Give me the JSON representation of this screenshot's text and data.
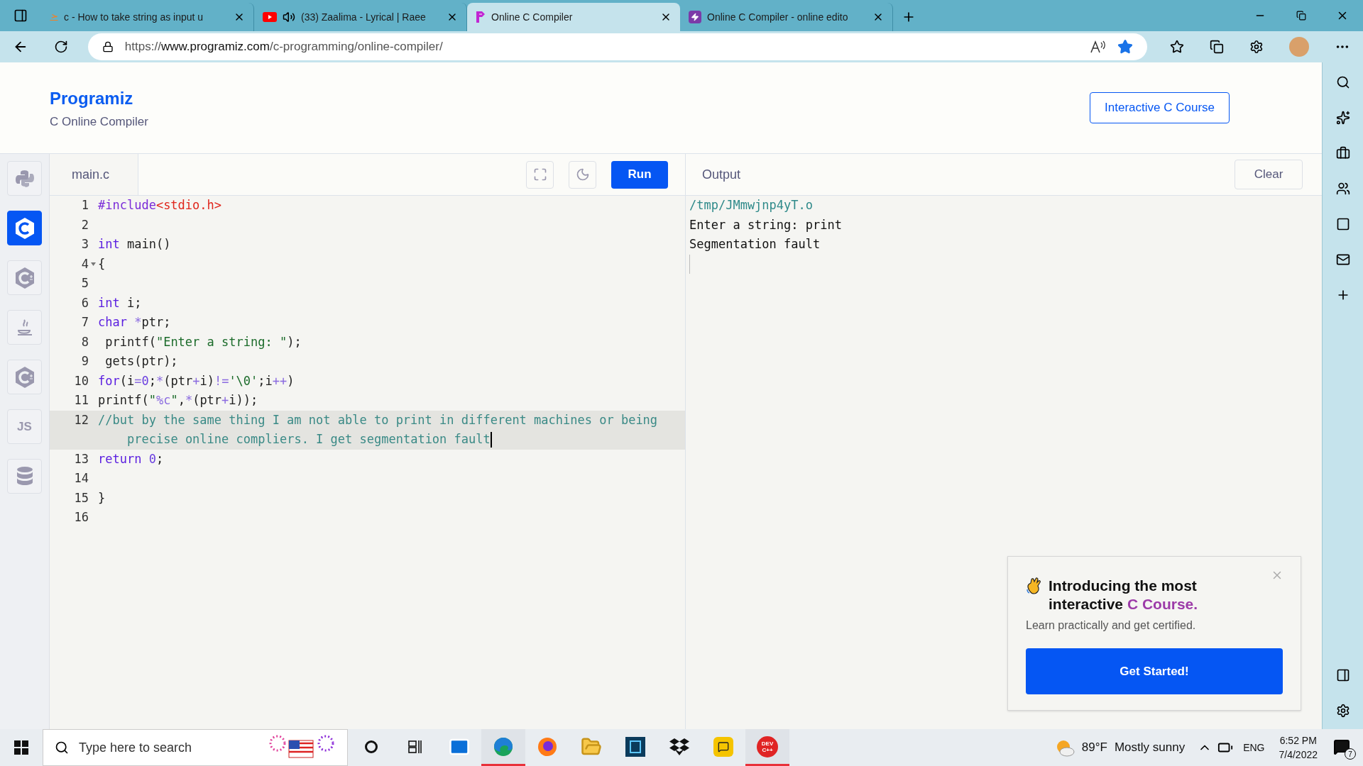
{
  "browser": {
    "tabs": [
      {
        "title": "c - How to take string as input u",
        "kind": "flame",
        "audio": false,
        "selected": false
      },
      {
        "title": "(33) Zaalima - Lyrical | Raee",
        "kind": "play",
        "audio": true,
        "selected": false
      },
      {
        "title": "Online C Compiler",
        "kind": "p-logo",
        "audio": false,
        "selected": true
      },
      {
        "title": "Online C Compiler - online edito",
        "kind": "bolt",
        "audio": false,
        "selected": false
      }
    ],
    "address": {
      "scheme": "https://",
      "host": "www.programiz.com",
      "path": "/c-programming/online-compiler/",
      "favorited": true
    }
  },
  "header": {
    "logo": "Programiz",
    "subtitle": "C Online Compiler",
    "course_button": "Interactive C Course"
  },
  "languages": [
    {
      "kind": "python",
      "selected": false
    },
    {
      "kind": "c",
      "selected": true
    },
    {
      "kind": "cpp",
      "selected": false
    },
    {
      "kind": "java",
      "selected": false
    },
    {
      "kind": "csharp",
      "selected": false
    },
    {
      "kind": "js",
      "label": "JS",
      "selected": false
    },
    {
      "kind": "database",
      "selected": false
    }
  ],
  "editor": {
    "file_tab": "main.c",
    "run_button": "Run",
    "lines": [
      {
        "number": "1",
        "tokens": [
          {
            "kind": "meta",
            "text": "#include"
          },
          {
            "kind": "header",
            "text": "<stdio.h>"
          }
        ]
      },
      {
        "number": "2"
      },
      {
        "number": "3",
        "tokens": [
          {
            "kind": "keyword",
            "text": "int"
          },
          {
            "kind": "plain",
            "text": " main()"
          }
        ]
      },
      {
        "number": "4",
        "foldable": true,
        "tokens": [
          {
            "kind": "plain",
            "text": "{"
          }
        ]
      },
      {
        "number": "5"
      },
      {
        "number": "6",
        "tokens": [
          {
            "kind": "keyword",
            "text": "int"
          },
          {
            "kind": "plain",
            "text": " i;"
          }
        ]
      },
      {
        "number": "7",
        "tokens": [
          {
            "kind": "keyword",
            "text": "char"
          },
          {
            "kind": "operator",
            "text": " *"
          },
          {
            "kind": "plain",
            "text": "ptr;"
          }
        ]
      },
      {
        "number": "8",
        "tokens": [
          {
            "kind": "plain",
            "text": " printf("
          },
          {
            "kind": "string",
            "text": "\"Enter a string: \""
          },
          {
            "kind": "plain",
            "text": ");"
          }
        ]
      },
      {
        "number": "9",
        "tokens": [
          {
            "kind": "plain",
            "text": " gets(ptr);"
          }
        ]
      },
      {
        "number": "10",
        "tokens": [
          {
            "kind": "keyword",
            "text": "for"
          },
          {
            "kind": "plain",
            "text": "(i"
          },
          {
            "kind": "operator",
            "text": "="
          },
          {
            "kind": "number",
            "text": "0"
          },
          {
            "kind": "plain",
            "text": ";"
          },
          {
            "kind": "operator",
            "text": "*"
          },
          {
            "kind": "plain",
            "text": "(ptr"
          },
          {
            "kind": "operator",
            "text": "+"
          },
          {
            "kind": "plain",
            "text": "i)"
          },
          {
            "kind": "operator",
            "text": "!="
          },
          {
            "kind": "string",
            "text": "'\\0'"
          },
          {
            "kind": "plain",
            "text": ";i"
          },
          {
            "kind": "operator",
            "text": "++"
          },
          {
            "kind": "plain",
            "text": ")"
          }
        ]
      },
      {
        "number": "11",
        "tokens": [
          {
            "kind": "plain",
            "text": "printf("
          },
          {
            "kind": "string",
            "text": "\""
          },
          {
            "kind": "escape",
            "text": "%c"
          },
          {
            "kind": "string",
            "text": "\""
          },
          {
            "kind": "plain",
            "text": ","
          },
          {
            "kind": "operator",
            "text": "*"
          },
          {
            "kind": "plain",
            "text": "(ptr"
          },
          {
            "kind": "operator",
            "text": "+"
          },
          {
            "kind": "plain",
            "text": "i));"
          }
        ]
      },
      {
        "number": "12",
        "active": true,
        "cursor": true,
        "tokens": [
          {
            "kind": "comment",
            "text": "//but by the same thing I am not able to print in different machines or being precise online compliers. I get segmentation fault"
          }
        ]
      },
      {
        "number": "13",
        "tokens": [
          {
            "kind": "keyword",
            "text": "return"
          },
          {
            "kind": "number",
            "text": " 0"
          },
          {
            "kind": "plain",
            "text": ";"
          }
        ]
      },
      {
        "number": "14"
      },
      {
        "number": "15",
        "tokens": [
          {
            "kind": "plain",
            "text": "}"
          }
        ]
      },
      {
        "number": "16"
      }
    ]
  },
  "output": {
    "title": "Output",
    "clear_button": "Clear",
    "lines": [
      {
        "kind": "path",
        "text": "/tmp/JMmwjnp4yT.o"
      },
      {
        "kind": "plain",
        "text": "Enter a string: print"
      },
      {
        "kind": "plain",
        "text": "Segmentation fault"
      }
    ]
  },
  "promo": {
    "title": "Introducing the most interactive ",
    "title_highlight": "C Course.",
    "subtitle": "Learn practically and get certified.",
    "button": "Get Started!"
  },
  "taskbar": {
    "search_placeholder": "Type here to search",
    "apps": [
      {
        "kind": "cortana",
        "active": false
      },
      {
        "kind": "taskview",
        "active": false
      },
      {
        "kind": "mail",
        "active": false
      },
      {
        "kind": "edge",
        "active": true
      },
      {
        "kind": "firefox",
        "active": false
      },
      {
        "kind": "folder",
        "active": false
      },
      {
        "kind": "store",
        "active": false
      },
      {
        "kind": "dropbox",
        "active": false
      },
      {
        "kind": "chat",
        "active": false
      },
      {
        "kind": "devcpp",
        "label": "DEV C++",
        "active": true
      }
    ],
    "temperature": "89°F",
    "weather": "Mostly sunny",
    "language": "ENG",
    "time": "6:52 PM",
    "date": "7/4/2022",
    "notifications": "7"
  }
}
